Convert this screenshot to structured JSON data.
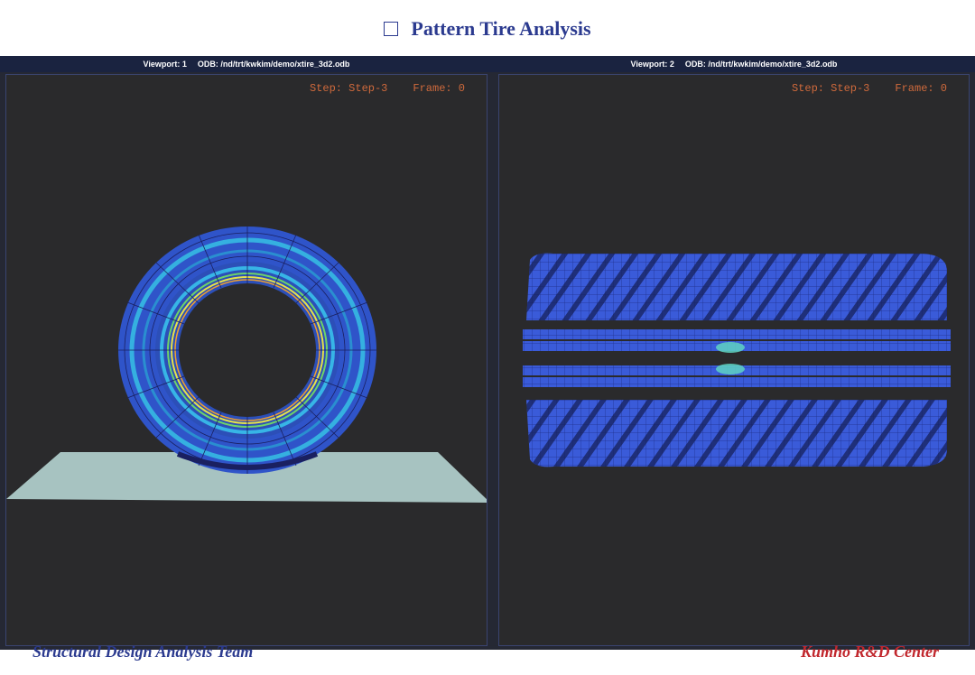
{
  "slide": {
    "title": "Pattern Tire Analysis",
    "footer_left": "Structural Design Analysis Team",
    "footer_right": "Kumho R&D Center"
  },
  "viewports": [
    {
      "label": "Viewport: 1",
      "odb": "ODB: /nd/trt/kwkim/demo/xtire_3d2.odb",
      "step": "Step: Step-3",
      "frame": "Frame: 0"
    },
    {
      "label": "Viewport: 2",
      "odb": "ODB: /nd/trt/kwkim/demo/xtire_3d2.odb",
      "step": "Step: Step-3",
      "frame": "Frame: 0"
    }
  ],
  "colors": {
    "title": "#2b3a8f",
    "footer_right": "#c1272d",
    "status_text": "#d06a3c",
    "viewport_bg": "#2a2a2c",
    "tire_blue": "#3a5bd9",
    "ground": "#a7c3c1"
  }
}
